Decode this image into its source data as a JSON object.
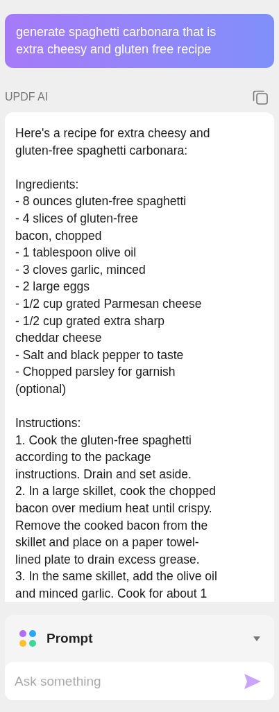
{
  "user_message": "generate spaghetti carbonara that is extra cheesy and gluten free recipe",
  "assistant": {
    "name": "UPDF AI",
    "paragraphs": [
      {
        "lines": [
          "Here's a recipe for extra cheesy and",
          "gluten-free spaghetti carbonara:"
        ]
      },
      {
        "lines": [
          "Ingredients:",
          "- 8 ounces gluten-free spaghetti",
          "- 4 slices of gluten-free",
          "bacon, chopped",
          "- 1 tablespoon olive oil",
          "- 3 cloves garlic, minced",
          "- 2 large eggs",
          "- 1/2 cup grated Parmesan cheese",
          "- 1/2 cup grated extra sharp",
          "cheddar cheese",
          "- Salt and black pepper to taste",
          "- Chopped parsley for garnish",
          "(optional)"
        ]
      },
      {
        "lines": [
          "Instructions:",
          "1. Cook the gluten-free spaghetti",
          "according to the package",
          "instructions. Drain and set aside.",
          "2. In a large skillet, cook the chopped",
          "bacon over medium heat until crispy.",
          "Remove the cooked bacon from the",
          "skillet and place on a paper towel-",
          "lined plate to drain excess grease.",
          "3. In the same skillet, add the olive oil",
          "and minced garlic. Cook for about 1"
        ]
      }
    ]
  },
  "composer": {
    "mode": "Prompt",
    "placeholder": "Ask something"
  }
}
